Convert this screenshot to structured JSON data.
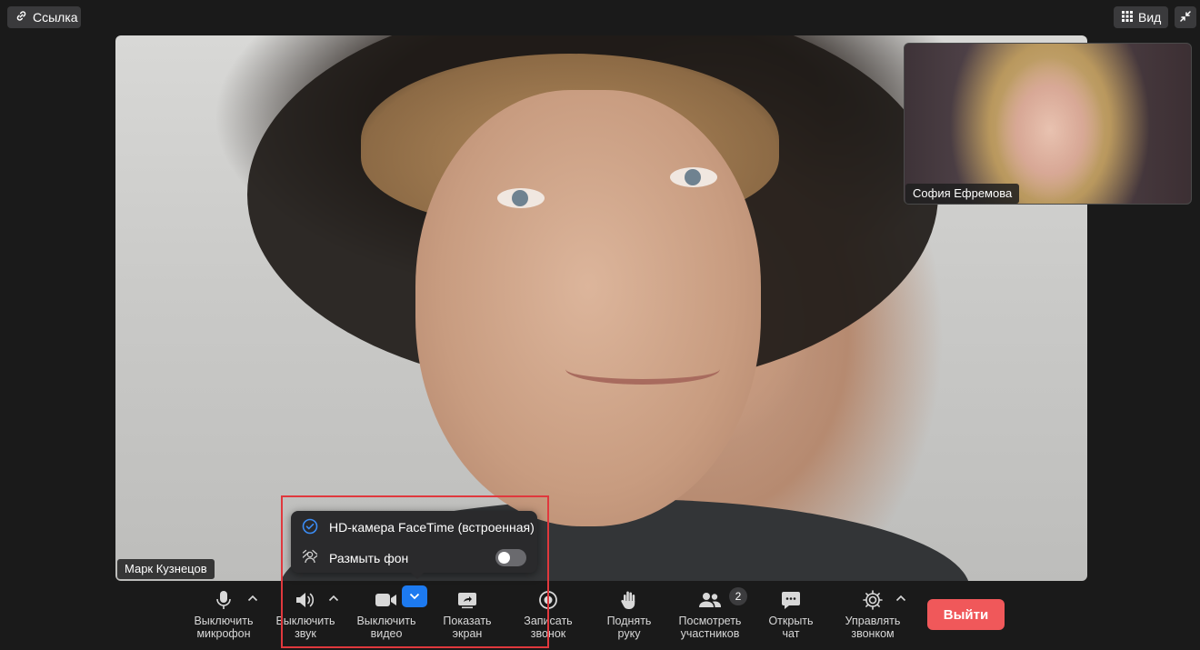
{
  "top_bar": {
    "link_label": "Ссылка",
    "view_label": "Вид"
  },
  "main_video": {
    "participant_name": "Марк Кузнецов"
  },
  "thumbnail_video": {
    "participant_name": "София Ефремова"
  },
  "camera_popup": {
    "camera_option": "HD-камера FaceTime (встроенная)",
    "camera_selected": true,
    "blur_label": "Размыть фон",
    "blur_enabled": false
  },
  "controls": {
    "mic_label_1": "Выключить",
    "mic_label_2": "микрофон",
    "sound_label_1": "Выключить",
    "sound_label_2": "звук",
    "video_label_1": "Выключить",
    "video_label_2": "видео",
    "share_label_1": "Показать",
    "share_label_2": "экран",
    "record_label_1": "Записать",
    "record_label_2": "звонок",
    "hand_label_1": "Поднять",
    "hand_label_2": "руку",
    "participants_label_1": "Посмотреть",
    "participants_label_2": "участников",
    "participants_count": "2",
    "chat_label_1": "Открыть",
    "chat_label_2": "чат",
    "manage_label_1": "Управлять",
    "manage_label_2": "звонком",
    "exit_label": "Выйти"
  },
  "colors": {
    "accent_blue": "#1d7af0",
    "exit_red": "#f0585a",
    "highlight_red": "#e0383d",
    "background": "#1a1a1a"
  },
  "icons": [
    "link-icon",
    "grid-icon",
    "collapse-icon",
    "microphone-icon",
    "speaker-icon",
    "camera-icon",
    "share-screen-icon",
    "record-icon",
    "hand-icon",
    "participants-icon",
    "chat-icon",
    "gear-icon",
    "check-circle-icon",
    "blur-icon",
    "chevron-up-icon",
    "chevron-down-icon"
  ]
}
